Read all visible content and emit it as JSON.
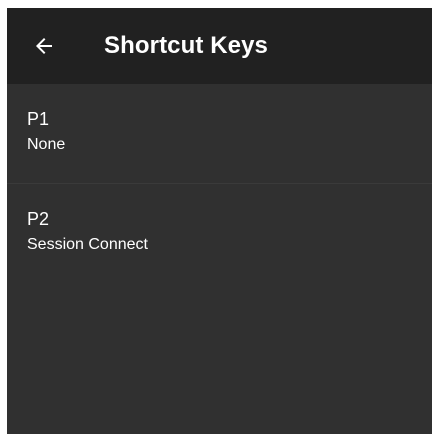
{
  "app_bar": {
    "title": "Shortcut Keys",
    "back_icon": "arrow-left-icon"
  },
  "shortcuts": [
    {
      "key": "P1",
      "value": "None"
    },
    {
      "key": "P2",
      "value": "Session Connect"
    }
  ],
  "colors": {
    "app_bar_bg": "#212121",
    "screen_bg": "#303030",
    "text": "#ffffff"
  }
}
